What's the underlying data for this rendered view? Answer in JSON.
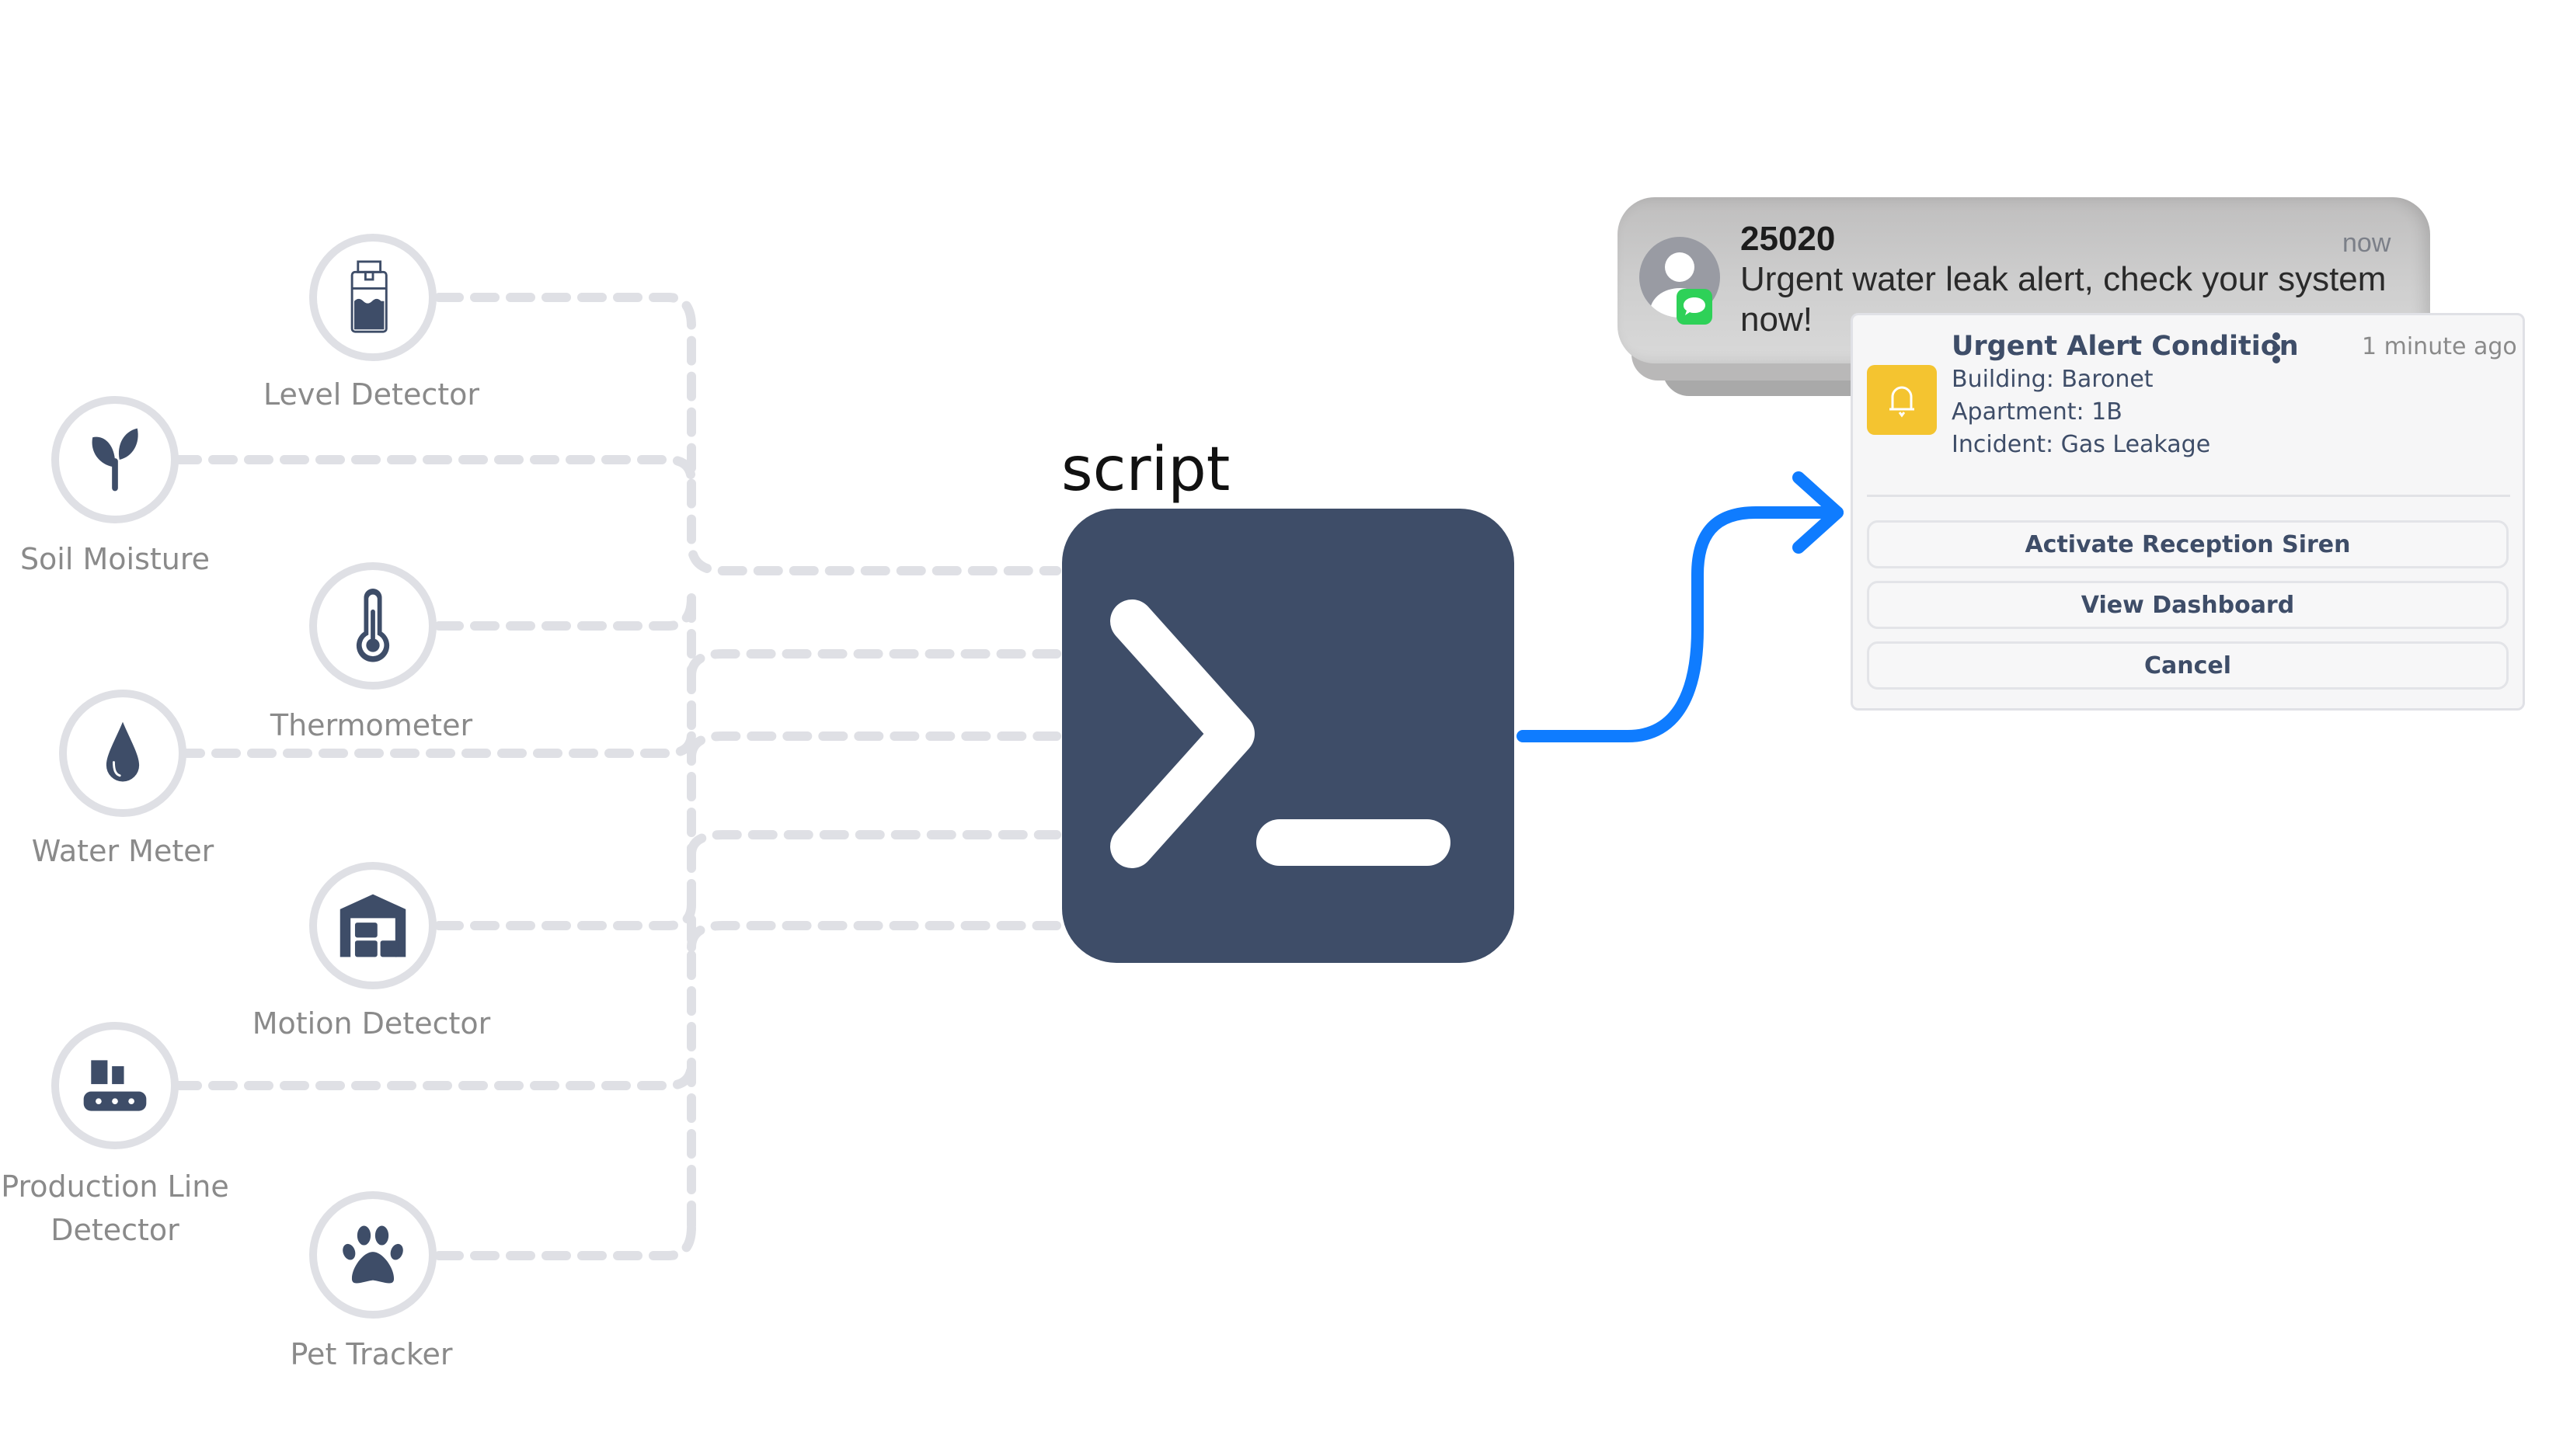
{
  "colors": {
    "icon": "#3e4d68",
    "node_ring": "#dfe0e5",
    "connector": "#dfe0e5",
    "label": "#8a8a8a",
    "arrow": "#0f7cff",
    "alert_icon_bg": "#f4c430",
    "imessage_green": "#2ed158"
  },
  "sensors": [
    {
      "id": "level",
      "label": "Level Detector",
      "icon": "level-detector-icon"
    },
    {
      "id": "soil",
      "label": "Soil Moisture",
      "icon": "sprout-icon"
    },
    {
      "id": "thermo",
      "label": "Thermometer",
      "icon": "thermometer-icon"
    },
    {
      "id": "water",
      "label": "Water Meter",
      "icon": "water-drop-icon"
    },
    {
      "id": "motion",
      "label": "Motion Detector",
      "icon": "warehouse-icon"
    },
    {
      "id": "production",
      "label": "Production Line Detector",
      "label_lines": [
        "Production Line",
        "Detector"
      ],
      "icon": "conveyor-icon"
    },
    {
      "id": "pet",
      "label": "Pet Tracker",
      "icon": "paw-icon"
    }
  ],
  "script": {
    "title": "script",
    "icon": "terminal-prompt-icon"
  },
  "sms_notification": {
    "sender": "25020",
    "time": "now",
    "message": "Urgent water leak alert, check your system now!",
    "avatar_icon": "contact-avatar-icon",
    "badge_icon": "messages-app-icon"
  },
  "alert_card": {
    "title": "Urgent Alert Condition",
    "time": "1 minute ago",
    "icon": "bell-icon",
    "menu_icon": "more-vertical-icon",
    "details": [
      "Building: Baronet",
      "Apartment: 1B",
      "Incident: Gas Leakage"
    ],
    "buttons": [
      {
        "label": "Activate Reception Siren"
      },
      {
        "label": "View Dashboard"
      },
      {
        "label": "Cancel"
      }
    ]
  }
}
